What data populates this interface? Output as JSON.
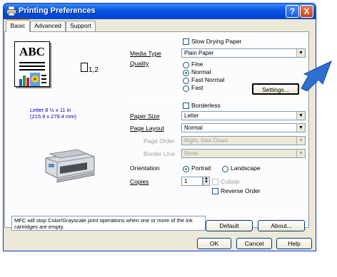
{
  "window": {
    "title": "Printing Preferences",
    "help_glyph": "?",
    "close_glyph": "X"
  },
  "tabs": [
    {
      "label": "Basic",
      "active": true
    },
    {
      "label": "Advanced",
      "active": false
    },
    {
      "label": "Support",
      "active": false
    }
  ],
  "preview": {
    "text": "ABC",
    "paper_icon_label": "1,2",
    "paper_size_line1": "Letter 8 ½ x 11 in",
    "paper_size_line2": "(215.9 x 279.4 mm)"
  },
  "media": {
    "slow_drying_label": "Slow Drying Paper",
    "media_type_label": "Media Type",
    "media_type_value": "Plain Paper"
  },
  "quality": {
    "label": "Quality",
    "options": [
      "Fine",
      "Normal",
      "Fast Normal",
      "Fast"
    ],
    "selected": "Normal",
    "settings_button": "Settings..."
  },
  "layout": {
    "borderless_label": "Borderless",
    "paper_size_label": "Paper Size",
    "paper_size_value": "Letter",
    "page_layout_label": "Page Layout",
    "page_layout_value": "Normal",
    "page_order_label": "Page Order",
    "page_order_value": "Right, then Down",
    "border_line_label": "Border Line",
    "border_line_value": "None"
  },
  "orientation": {
    "label": "Orientation",
    "portrait": "Portrait",
    "landscape": "Landscape",
    "selected": "Portrait"
  },
  "copies": {
    "label": "Copies",
    "value": "1",
    "collate_label": "Collate",
    "reverse_order_label": "Reverse Order"
  },
  "footer": {
    "message": "MFC will stop Color/Grayscale print operations when one or more of the ink cartridges are empty.",
    "default_button": "Default",
    "about_button": "About...",
    "ok_button": "OK",
    "cancel_button": "Cancel",
    "help_button": "Help"
  },
  "colors": {
    "titlebar": "#0a5ae6",
    "pointer_arrow": "#2f6fd0",
    "info_text": "#0000c0",
    "selected_radio": "#21a121"
  }
}
